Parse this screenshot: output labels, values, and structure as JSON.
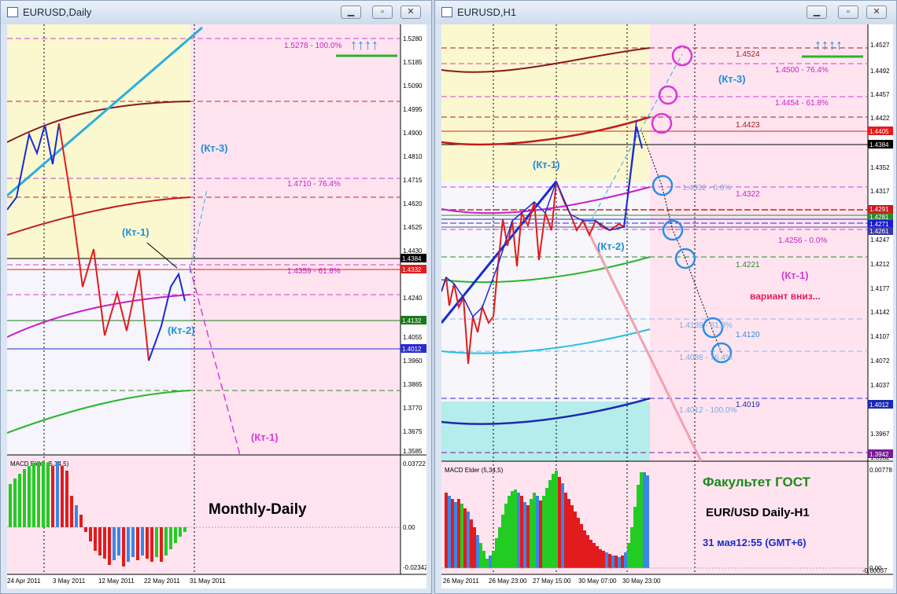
{
  "left_window": {
    "title": "EURUSD,Daily",
    "buttons": {
      "minimize": "▁",
      "restore": "▫",
      "close": "✕"
    },
    "price_ticks": [
      "1.5280",
      "1.5185",
      "1.5090",
      "1.4995",
      "1.4900",
      "1.4810",
      "1.4715",
      "1.4620",
      "1.4525",
      "1.4430",
      "1.4335",
      "1.4240",
      "1.4150",
      "1.4055",
      "1.3960",
      "1.3865",
      "1.3770",
      "1.3675",
      "1.3585"
    ],
    "price_labels": {
      "current": "1.4384",
      "red": "1.4332",
      "green": "1.4132",
      "blue": "1.4012"
    },
    "fib_labels": {
      "f100": "1.5278 - 100.0%",
      "f76": "1.4710 - 76.4%",
      "f61": "1.4359 - 61.8%"
    },
    "wave_labels": {
      "kt3": "(Кт-3)",
      "kt1": "(Кт-1)",
      "kt2": "(Кт-2)",
      "kt1_down": "(Кт-1)"
    },
    "arrows": "↑↑↑↑",
    "macd_title": "MACD Elder (5,34,5)",
    "macd_ticks": [
      "0.03722",
      "0.00",
      "-0.02342"
    ],
    "caption": "Monthly-Daily",
    "time_labels": [
      "24 Apr 2011",
      "3 May 2011",
      "12 May 2011",
      "22 May 2011",
      "31 May 2011"
    ]
  },
  "right_window": {
    "title": "EURUSD,H1",
    "buttons": {
      "minimize": "▁",
      "restore": "▫",
      "close": "✕"
    },
    "price_ticks": [
      "1.4527",
      "1.4492",
      "1.4457",
      "1.4422",
      "1.4387",
      "1.4352",
      "1.4317",
      "1.4282",
      "1.4247",
      "1.4212",
      "1.4177",
      "1.4142",
      "1.4107",
      "1.4072",
      "1.4037",
      "1.4002",
      "1.3967",
      "1.3932"
    ],
    "price_labels": {
      "l1": "1.4405",
      "l2": "1.4384",
      "l3": "1.4291",
      "l4": "1.4281",
      "l5": "1.4271",
      "l6": "1.4261",
      "l7": "1.4012",
      "l8": "1.3942"
    },
    "level_labels": {
      "a": "1.4524",
      "b": "1.4500 - 76.4%",
      "c": "1.4454 - 61.8%",
      "d": "1.4423",
      "e": "1.4332 - 0.0%",
      "f": "1.4322",
      "g": "1.4256 - 0.0%",
      "h": "1.4221",
      "i": "1.4120",
      "j": "1.4139 - 61.8%",
      "k": "1.4088 - 76.4%",
      "l": "1.4019",
      "m": "1.4012 - 100.0%"
    },
    "wave_labels": {
      "kt1": "(Кт-1)",
      "kt2": "(Кт-2)",
      "kt3": "(Кт-3)",
      "kt1_alt": "(Кт-1)",
      "variant": "вариант вниз..."
    },
    "arrows": "↑↑↑↑",
    "macd_title": "MACD Elder (5,34,5)",
    "macd_ticks": [
      "0.00778",
      "0.00",
      "-0.00037"
    ],
    "caption_title": "Факультет ГОСТ",
    "caption_pair": "EUR/USD Daily-H1",
    "caption_date": "31 мая12:55 (GMT+6)",
    "time_labels": [
      "26 May 2011",
      "26 May 23:00",
      "27 May 15:00",
      "30 May 07:00",
      "30 May 23:00"
    ]
  },
  "colors": {
    "pink_bg": "#ffe4f0",
    "yellow_bg": "#fbf8cf",
    "cyan_bg": "#b5ecec",
    "fib_magenta": "#d63ad6",
    "wave_blue": "#1a2bd0",
    "wave_red": "#e21c1c",
    "label_blue": "#1e8fd8"
  }
}
